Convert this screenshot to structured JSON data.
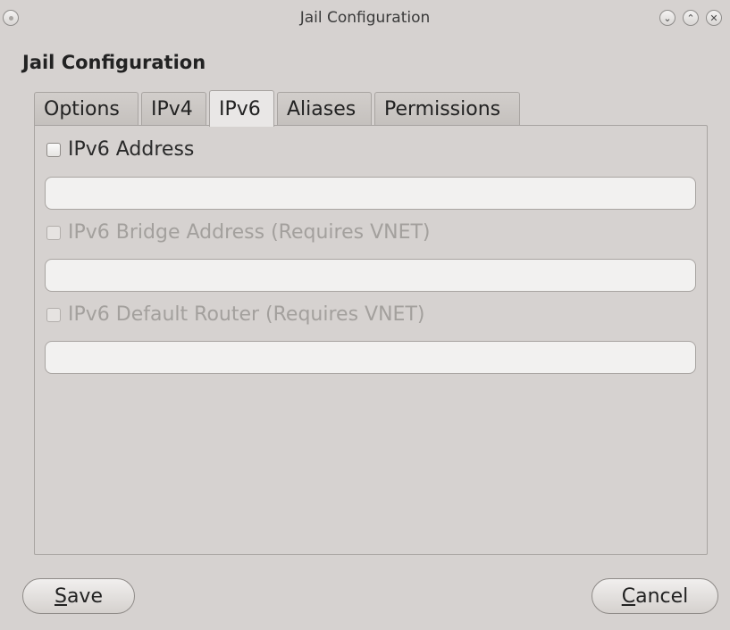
{
  "window": {
    "title": "Jail Configuration",
    "controls": {
      "menu_icon": "window-menu-icon",
      "minimize_glyph": "⌄",
      "maximize_glyph": "⌃",
      "close_glyph": "✕"
    }
  },
  "dialog": {
    "heading": "Jail Configuration"
  },
  "tabs": [
    {
      "label": "Options",
      "active": false
    },
    {
      "label": "IPv4",
      "active": false
    },
    {
      "label": "IPv6",
      "active": true
    },
    {
      "label": "Aliases",
      "active": false
    },
    {
      "label": "Permissions",
      "active": false
    }
  ],
  "ipv6": {
    "address": {
      "label": "IPv6 Address",
      "checked": false,
      "enabled": true,
      "value": ""
    },
    "bridge": {
      "label": "IPv6 Bridge Address (Requires VNET)",
      "checked": false,
      "enabled": false,
      "value": ""
    },
    "router": {
      "label": "IPv6 Default Router (Requires VNET)",
      "checked": false,
      "enabled": false,
      "value": ""
    }
  },
  "buttons": {
    "save": {
      "mnemonic": "S",
      "rest": "ave"
    },
    "cancel": {
      "mnemonic": "C",
      "rest": "ancel"
    }
  }
}
